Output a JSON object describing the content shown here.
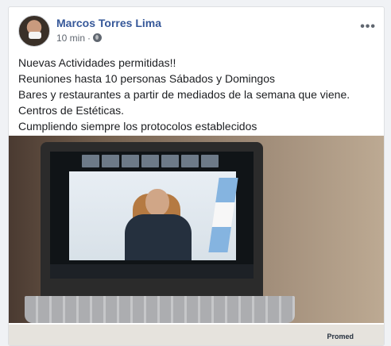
{
  "post": {
    "author": "Marcos Torres Lima",
    "time": "10 min",
    "separator": "·",
    "lines": [
      "Nuevas Actividades permitidas!!",
      "Reuniones hasta 10 personas Sábados y Domingos",
      "Bares y restaurantes a partir de mediados de la semana que viene.",
      "Centros de Estéticas.",
      "Cumpliendo siempre los protocolos establecidos"
    ],
    "more_label": "•••"
  },
  "second_photo": {
    "visible_text": "Promed"
  },
  "icons": {
    "audience": "globe-icon",
    "menu": "more-options-icon"
  }
}
